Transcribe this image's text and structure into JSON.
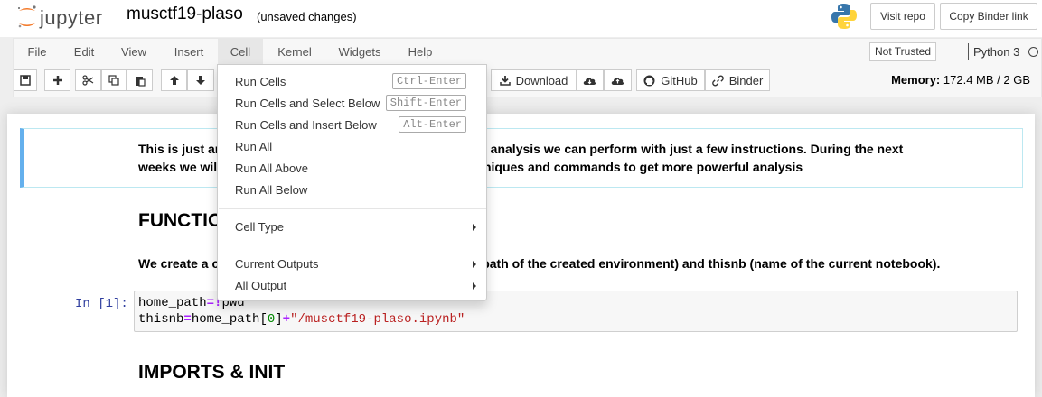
{
  "header": {
    "logo_text": "jupyter",
    "notebook_name": "musctf19-plaso",
    "save_status": "(unsaved changes)",
    "visit_repo": "Visit repo",
    "copy_binder": "Copy Binder link"
  },
  "menubar": {
    "items": [
      "File",
      "Edit",
      "View",
      "Insert",
      "Cell",
      "Kernel",
      "Widgets",
      "Help"
    ],
    "not_trusted": "Not Trusted",
    "kernel_name": "Python 3"
  },
  "toolbar": {
    "download": "Download",
    "github": "GitHub",
    "binder": "Binder",
    "memory_label": "Memory:",
    "memory_value": "172.4 MB / 2 GB"
  },
  "notebook": {
    "info_line1": "This is just an introductory notebook to show some of the analysis we can perform with just a few instructions. During the next",
    "info_line2": "weeks we will be improving it and incorporating new techniques and commands to get more powerful analysis",
    "heading1": "FUNCTIONS",
    "para1": "We create a couple of variables called home_path (home path of the created environment) and thisnb (name of the current notebook).",
    "prompt": "In [1]:",
    "code_line1_a": "home_path",
    "code_line1_op": "=!",
    "code_line1_b": "pwd",
    "code_line2_a": "thisnb",
    "code_line2_op1": "=",
    "code_line2_b": "home_path[",
    "code_line2_num": "0",
    "code_line2_c": "]",
    "code_line2_op2": "+",
    "code_line2_str": "\"/musctf19-plaso.ipynb\"",
    "heading2": "IMPORTS & INIT"
  },
  "cell_menu": {
    "run_cells": "Run Cells",
    "run_cells_key": "Ctrl-Enter",
    "run_select_below": "Run Cells and Select Below",
    "run_select_below_key": "Shift-Enter",
    "run_insert_below": "Run Cells and Insert Below",
    "run_insert_below_key": "Alt-Enter",
    "run_all": "Run All",
    "run_all_above": "Run All Above",
    "run_all_below": "Run All Below",
    "cell_type": "Cell Type",
    "current_outputs": "Current Outputs",
    "all_output": "All Output"
  },
  "colors": {
    "info_border": "#64b0ed",
    "prompt": "#303f9f",
    "operator": "#aa22ff",
    "string": "#ba2121",
    "number": "#008800"
  }
}
